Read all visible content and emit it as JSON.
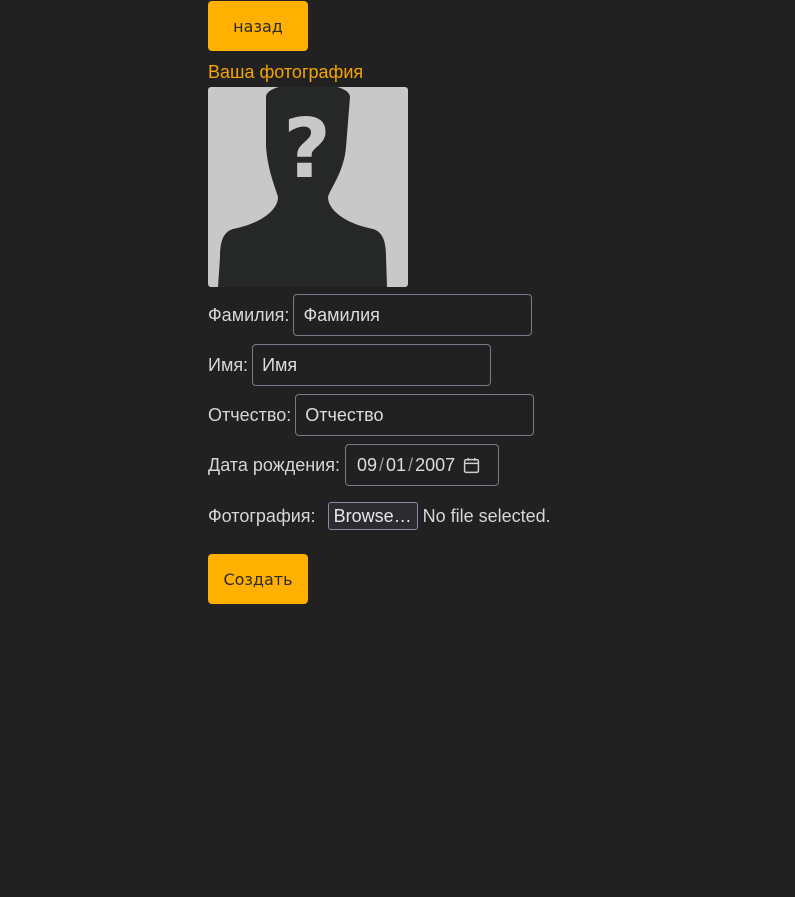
{
  "nav": {
    "back_label": "назад"
  },
  "photo": {
    "heading": "Ваша фотография",
    "placeholder_icon": "unknown-person-silhouette"
  },
  "form": {
    "last_name": {
      "label": "Фамилия:",
      "value": "Фамилия"
    },
    "first_name": {
      "label": "Имя:",
      "value": "Имя"
    },
    "patronymic": {
      "label": "Отчество:",
      "value": "Отчество"
    },
    "birth_date": {
      "label": "Дата рождения:",
      "month": "09",
      "day": "01",
      "year": "2007",
      "sep": "/",
      "icon": "calendar-icon"
    },
    "photo_file": {
      "label": "Фотография:",
      "browse_label": "Browse…",
      "status": "No file selected."
    },
    "submit_label": "Создать"
  },
  "colors": {
    "background": "#212121",
    "accent": "#ffb000",
    "heading": "#f5a400"
  }
}
